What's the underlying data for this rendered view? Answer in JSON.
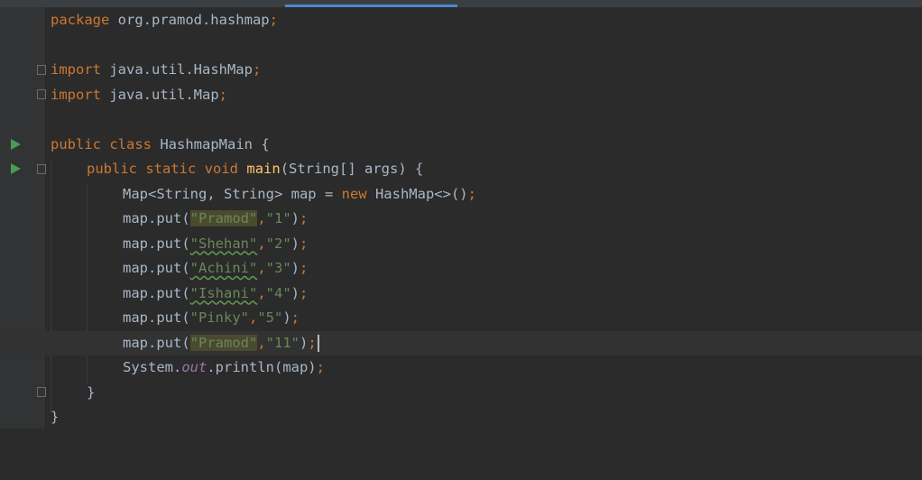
{
  "editor": {
    "lines": [
      {
        "package_kw": "package",
        "package_name": " org.pramod.hashmap",
        "semi": ";"
      },
      {},
      {
        "import_kw": "import",
        "import_name": " java.util.HashMap",
        "semi": ";"
      },
      {
        "import_kw": "import",
        "import_name": " java.util.Map",
        "semi": ";"
      },
      {},
      {
        "public": "public",
        "class": "class",
        "name": " HashmapMain {"
      },
      {
        "public": "public",
        "static": "static",
        "void": "void",
        "method": "main",
        "params": "(String[] args) {"
      },
      {
        "decl": "Map<String, String> map = ",
        "new": "new",
        "ctor": " HashMap<>()",
        "semi": ";"
      },
      {
        "call": "map.put(",
        "key": "\"Pramod\"",
        "comma": ",",
        "value": "\"1\"",
        "close": ")",
        "semi": ";"
      },
      {
        "call": "map.put(",
        "key": "\"Shehan\"",
        "comma": ",",
        "value": "\"2\"",
        "close": ")",
        "semi": ";"
      },
      {
        "call": "map.put(",
        "key": "\"Achini\"",
        "comma": ",",
        "value": "\"3\"",
        "close": ")",
        "semi": ";"
      },
      {
        "call": "map.put(",
        "key": "\"Ishani\"",
        "comma": ",",
        "value": "\"4\"",
        "close": ")",
        "semi": ";"
      },
      {
        "call": "map.put(",
        "key": "\"Pinky\"",
        "comma": ",",
        "value": "\"5\"",
        "close": ")",
        "semi": ";"
      },
      {
        "call": "map.put(",
        "key": "\"Pramod\"",
        "comma": ",",
        "value": "\"11\"",
        "close": ")",
        "semi": ";"
      },
      {
        "sys": "System.",
        "out": "out",
        "println": ".println(map)",
        "semi": ";"
      },
      {
        "brace": "}"
      },
      {
        "brace": "}"
      }
    ]
  },
  "colors": {
    "background": "#2b2b2b",
    "keyword": "#cc7832",
    "string": "#6a8759",
    "method": "#ffc66d",
    "field": "#9876aa",
    "text": "#a9b7c6",
    "run_icon": "#499c54",
    "active_tab": "#4a88c7"
  },
  "icons": {
    "run": "run-gutter-icon",
    "fold": "fold-marker-icon"
  }
}
